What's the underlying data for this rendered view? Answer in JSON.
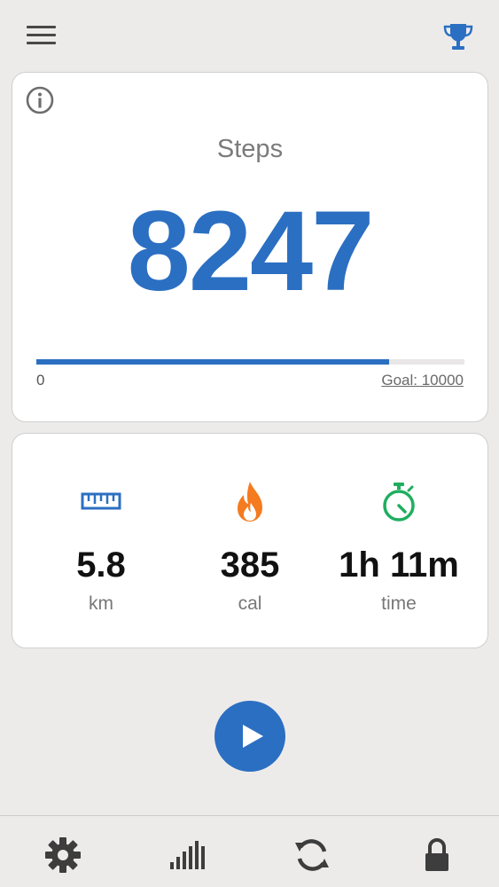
{
  "header": {
    "menu_icon": "hamburger-menu-icon",
    "trophy_icon": "trophy-icon"
  },
  "steps_card": {
    "info_icon": "info-icon",
    "label": "Steps",
    "value": "8247",
    "progress_min": "0",
    "goal_label": "Goal: 10000",
    "progress_fraction": 0.8247
  },
  "stats": {
    "distance": {
      "value": "5.8",
      "unit": "km",
      "icon": "ruler-icon"
    },
    "calories": {
      "value": "385",
      "unit": "cal",
      "icon": "flame-icon"
    },
    "time": {
      "value": "1h 11m",
      "unit": "time",
      "icon": "stopwatch-icon"
    }
  },
  "controls": {
    "play_icon": "play-icon"
  },
  "bottom_nav": {
    "items": [
      "settings-gear-icon",
      "bar-chart-icon",
      "refresh-icon",
      "lock-icon"
    ]
  },
  "colors": {
    "accent": "#2b6fc2",
    "background": "#edebea",
    "flame": "#f47b20",
    "stopwatch": "#1fae5f"
  }
}
